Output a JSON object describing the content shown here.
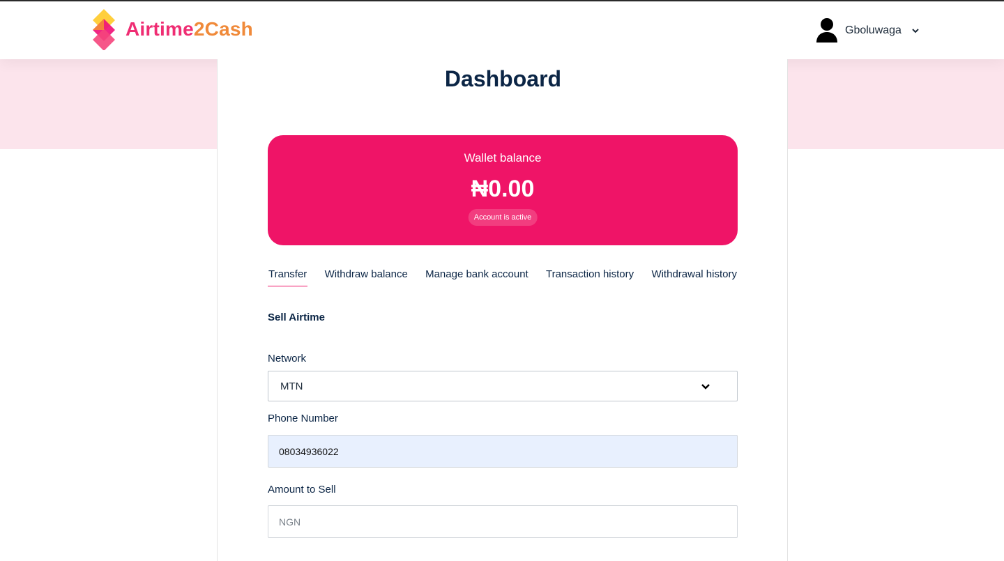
{
  "brand": {
    "name_part1": "Airtime",
    "name_part2": "2Cash",
    "accent": "#ef1467",
    "accent_orange": "#f08a3a"
  },
  "user": {
    "name": "Gboluwaga",
    "avatar_icon": "user-silhouette-icon",
    "menu_icon": "chevron-down-icon"
  },
  "page": {
    "title": "Dashboard"
  },
  "wallet": {
    "label": "Wallet balance",
    "amount": "₦0.00",
    "status": "Account is active"
  },
  "tabs": [
    {
      "label": "Transfer",
      "active": true
    },
    {
      "label": "Withdraw balance",
      "active": false
    },
    {
      "label": "Manage bank account",
      "active": false
    },
    {
      "label": "Transaction history",
      "active": false
    },
    {
      "label": "Withdrawal history",
      "active": false
    }
  ],
  "form": {
    "title": "Sell Airtime",
    "network": {
      "label": "Network",
      "value": "MTN"
    },
    "phone": {
      "label": "Phone Number",
      "value": "08034936022"
    },
    "amount": {
      "label": "Amount to Sell",
      "value": "",
      "placeholder": "NGN"
    }
  }
}
